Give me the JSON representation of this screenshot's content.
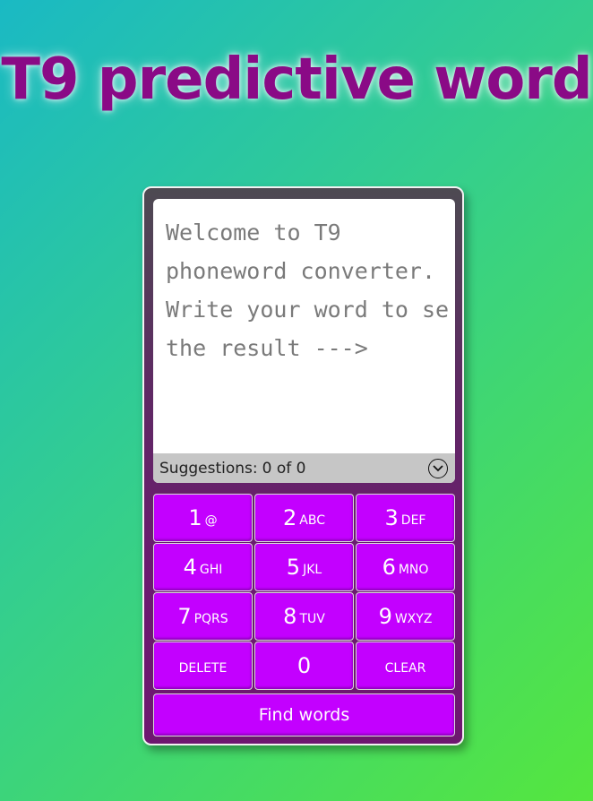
{
  "title": "T9 predictive word",
  "screen": {
    "text": "Welcome to T9 phoneword converter. Write your word to se the result --->"
  },
  "suggestions": {
    "label": "Suggestions:",
    "count": "0 of 0",
    "toggle_icon": "chevron-down-circle-icon"
  },
  "keys": [
    {
      "num": "1",
      "letters": "@"
    },
    {
      "num": "2",
      "letters": "ABC"
    },
    {
      "num": "3",
      "letters": "DEF"
    },
    {
      "num": "4",
      "letters": "GHI"
    },
    {
      "num": "5",
      "letters": "JKL"
    },
    {
      "num": "6",
      "letters": "MNO"
    },
    {
      "num": "7",
      "letters": "PQRS"
    },
    {
      "num": "8",
      "letters": "TUV"
    },
    {
      "num": "9",
      "letters": "WXYZ"
    }
  ],
  "bottom_row": {
    "delete_label": "DELETE",
    "zero_label": "0",
    "clear_label": "CLEAR"
  },
  "find_button": "Find words",
  "colors": {
    "title": "#8a0a86",
    "key": "#c300ff",
    "phone_body": "#6c1a70"
  }
}
